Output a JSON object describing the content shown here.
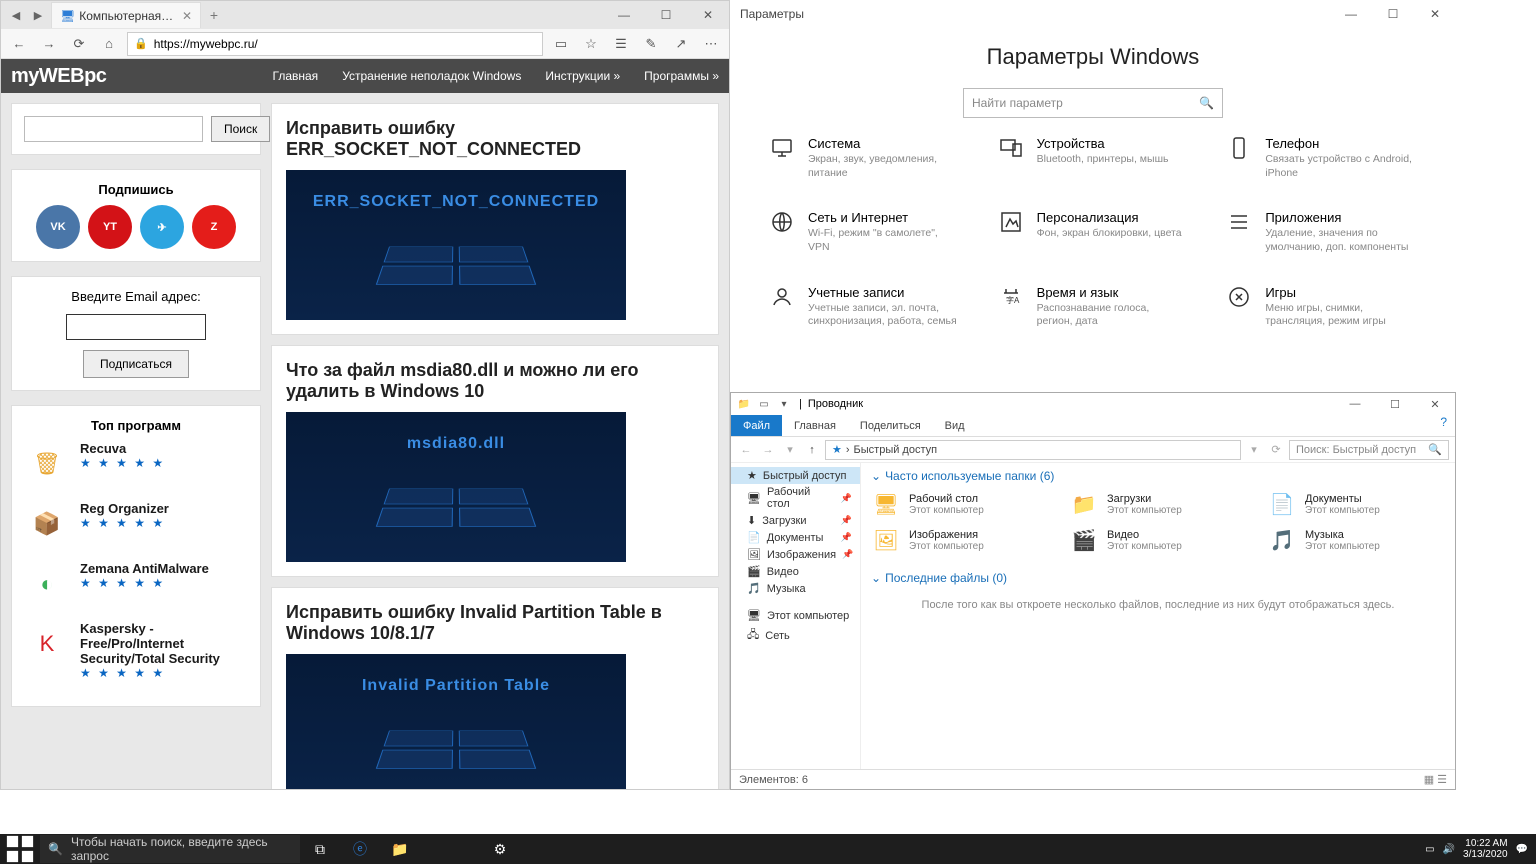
{
  "edge": {
    "tab_title": "Компьютерная помощ",
    "url": "https://mywebpc.ru/",
    "buttons": {
      "min": "—",
      "max": "☐",
      "close": "✕",
      "newtab": "+",
      "tabclose": "✕",
      "back": "←",
      "fwd": "→",
      "refresh": "⟳",
      "home": "⌂",
      "star": "☆",
      "read": "☰",
      "edit": "✎",
      "share": "↗",
      "more": "⋯"
    }
  },
  "site": {
    "logo": "myWEBpc",
    "nav": [
      "Главная",
      "Устранение неполадок Windows",
      "Инструкции »",
      "Программы »"
    ],
    "search_button": "Поиск",
    "subscribe_title": "Подпишись",
    "social": [
      {
        "name": "vk",
        "bg": "#4a76a8",
        "label": "VK"
      },
      {
        "name": "youtube",
        "bg": "#d31217",
        "label": "YT"
      },
      {
        "name": "telegram",
        "bg": "#2ca5e0",
        "label": "✈"
      },
      {
        "name": "zen",
        "bg": "#e41d1a",
        "label": "Z"
      }
    ],
    "email_label": "Введите Email адрес:",
    "email_button": "Подписаться",
    "top_title": "Топ программ",
    "programs": [
      {
        "name": "Recuva",
        "icon": "🗑",
        "color": "#e8a836"
      },
      {
        "name": "Reg Organizer",
        "icon": "📦",
        "color": "#e8a836"
      },
      {
        "name": "Zemana AntiMalware",
        "icon": "◐",
        "color": "#3bb05a"
      },
      {
        "name": "Kaspersky - Free/Pro/Internet Security/Total Security",
        "icon": "K",
        "color": "#d8232a"
      }
    ],
    "articles": [
      {
        "title": "Исправить ошибку ERR_SOCKET_NOT_CONNECTED",
        "caption": "ERR_SOCKET_NOT_CONNECTED"
      },
      {
        "title": "Что за файл msdia80.dll и можно ли его удалить в Windows 10",
        "caption": "msdia80.dll"
      },
      {
        "title": "Исправить ошибку Invalid Partition Table в Windows 10/8.1/7",
        "caption": "Invalid Partition Table"
      }
    ]
  },
  "settings": {
    "window_title": "Параметры",
    "heading": "Параметры Windows",
    "search_placeholder": "Найти параметр",
    "buttons": {
      "min": "—",
      "max": "☐",
      "close": "✕"
    },
    "items": [
      {
        "name": "Система",
        "desc": "Экран, звук, уведомления, питание",
        "icon": "monitor"
      },
      {
        "name": "Устройства",
        "desc": "Bluetooth, принтеры, мышь",
        "icon": "devices"
      },
      {
        "name": "Телефон",
        "desc": "Связать устройство с Android, iPhone",
        "icon": "phone"
      },
      {
        "name": "Сеть и Интернет",
        "desc": "Wi-Fi, режим \"в самолете\", VPN",
        "icon": "network"
      },
      {
        "name": "Персонализация",
        "desc": "Фон, экран блокировки, цвета",
        "icon": "personalize"
      },
      {
        "name": "Приложения",
        "desc": "Удаление, значения по умолчанию, доп. компоненты",
        "icon": "apps"
      },
      {
        "name": "Учетные записи",
        "desc": "Учетные записи, эл. почта, синхронизация, работа, семья",
        "icon": "account"
      },
      {
        "name": "Время и язык",
        "desc": "Распознавание голоса, регион, дата",
        "icon": "time"
      },
      {
        "name": "Игры",
        "desc": "Меню игры, снимки, трансляция, режим игры",
        "icon": "games"
      }
    ]
  },
  "explorer": {
    "title": "Проводник",
    "ribbon": {
      "file": "Файл",
      "home": "Главная",
      "share": "Поделиться",
      "view": "Вид"
    },
    "path_label": "Быстрый доступ",
    "search_placeholder": "Поиск: Быстрый доступ",
    "buttons": {
      "min": "—",
      "max": "☐",
      "close": "✕",
      "back": "←",
      "fwd": "→",
      "up": "↑",
      "dd": "▾",
      "ref": "⟳"
    },
    "nav": [
      {
        "label": "Быстрый доступ",
        "icon": "★",
        "selected": true,
        "pin": ""
      },
      {
        "label": "Рабочий стол",
        "icon": "🖥",
        "pin": "📌"
      },
      {
        "label": "Загрузки",
        "icon": "⬇",
        "pin": "📌"
      },
      {
        "label": "Документы",
        "icon": "📄",
        "pin": "📌"
      },
      {
        "label": "Изображения",
        "icon": "🖼",
        "pin": "📌"
      },
      {
        "label": "Видео",
        "icon": "🎬",
        "pin": ""
      },
      {
        "label": "Музыка",
        "icon": "🎵",
        "pin": ""
      },
      {
        "label": "Этот компьютер",
        "icon": "🖥",
        "pin": "",
        "gap": true
      },
      {
        "label": "Сеть",
        "icon": "🖧",
        "pin": ""
      }
    ],
    "section1": "Часто используемые папки (6)",
    "folders": [
      {
        "name": "Рабочий стол",
        "sub": "Этот компьютер",
        "icon": "🖥"
      },
      {
        "name": "Загрузки",
        "sub": "Этот компьютер",
        "icon": "📁"
      },
      {
        "name": "Документы",
        "sub": "Этот компьютер",
        "icon": "📄"
      },
      {
        "name": "Изображения",
        "sub": "Этот компьютер",
        "icon": "🖼"
      },
      {
        "name": "Видео",
        "sub": "Этот компьютер",
        "icon": "🎬"
      },
      {
        "name": "Музыка",
        "sub": "Этот компьютер",
        "icon": "🎵"
      }
    ],
    "section2": "Последние файлы (0)",
    "empty": "После того как вы откроете несколько файлов, последние из них будут отображаться здесь.",
    "status": "Элементов: 6"
  },
  "taskbar": {
    "search": "Чтобы начать поиск, введите здесь запрос",
    "time": "10:22 AM",
    "date": "3/13/2020"
  }
}
